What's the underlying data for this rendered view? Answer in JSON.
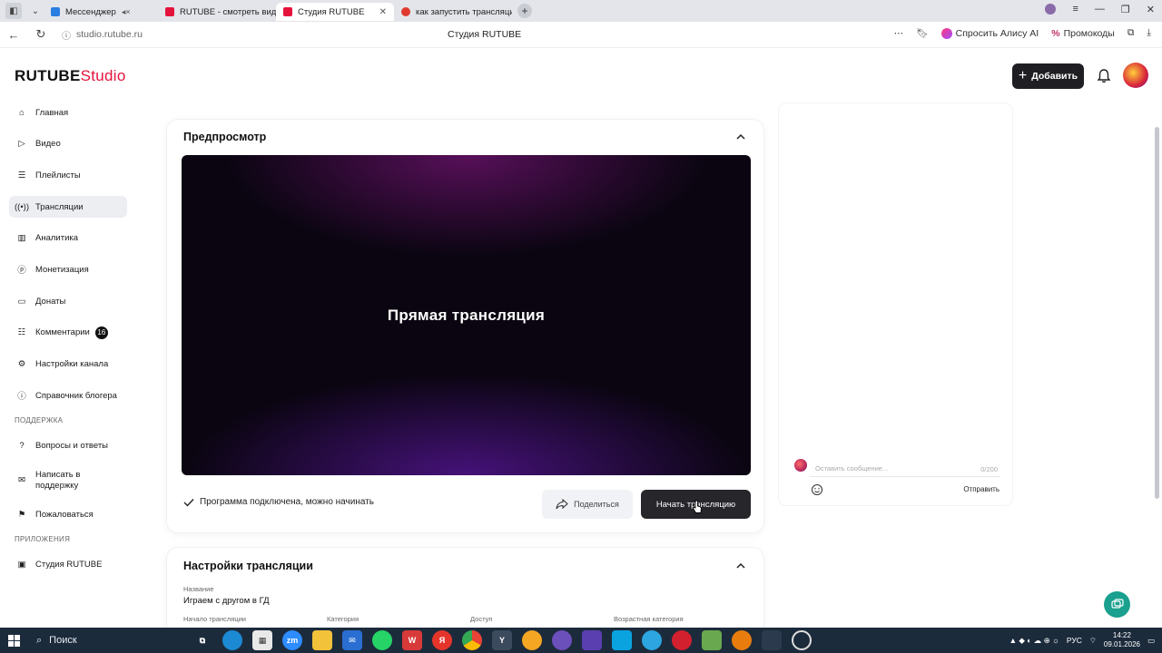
{
  "browser": {
    "tabs": [
      {
        "label": "Мессенджер",
        "favicon_color": "#2a7de1",
        "active": false
      },
      {
        "label": "RUTUBE - смотреть виде",
        "favicon_color": "#e5133c",
        "active": false
      },
      {
        "label": "Студия RUTUBE",
        "favicon_color": "#e5133c",
        "active": true
      },
      {
        "label": "как запустить трансляцию",
        "favicon_color": "#e03a2f",
        "active": false
      }
    ],
    "url": "studio.rutube.ru",
    "page_title": "Студия RUTUBE",
    "alice_label": "Спросить Алису AI",
    "promo_label": "Промокоды"
  },
  "header": {
    "logo_main": "RUTUBE",
    "logo_studio": "Studio",
    "add_label": "Добавить"
  },
  "sidebar": {
    "items": [
      {
        "label": "Главная",
        "icon": "home-icon"
      },
      {
        "label": "Видео",
        "icon": "video-icon"
      },
      {
        "label": "Плейлисты",
        "icon": "playlist-icon"
      },
      {
        "label": "Трансляции",
        "icon": "broadcast-icon",
        "active": true
      },
      {
        "label": "Аналитика",
        "icon": "analytics-icon"
      },
      {
        "label": "Монетизация",
        "icon": "monetization-icon"
      },
      {
        "label": "Донаты",
        "icon": "donate-icon"
      },
      {
        "label": "Комментарии",
        "icon": "comments-icon",
        "badge": "16"
      },
      {
        "label": "Настройки канала",
        "icon": "gear-icon"
      },
      {
        "label": "Справочник блогера",
        "icon": "info-icon"
      }
    ],
    "support_title": "ПОДДЕРЖКА",
    "support_items": [
      {
        "label": "Вопросы и ответы",
        "icon": "help-icon"
      },
      {
        "label": "Написать в поддержку",
        "icon": "mail-icon"
      },
      {
        "label": "Пожаловаться",
        "icon": "flag-icon"
      }
    ],
    "apps_title": "ПРИЛОЖЕНИЯ",
    "apps_items": [
      {
        "label": "Студия RUTUBE",
        "icon": "studio-icon"
      }
    ]
  },
  "preview": {
    "title": "Предпросмотр",
    "player_label": "Прямая трансляция",
    "status": "Программа подключена, можно начинать",
    "share_label": "Поделиться",
    "start_label": "Начать трансляцию"
  },
  "settings": {
    "title": "Настройки трансляции",
    "name_label": "Название",
    "name_value": "Играем с другом в ГД",
    "start_label": "Начало трансляции",
    "category_label": "Категория",
    "access_label": "Доступ",
    "age_label": "Возрастная категория"
  },
  "chat": {
    "placeholder": "Оставить сообщение...",
    "counter": "0/200",
    "send_label": "Отправить"
  },
  "taskbar": {
    "search_label": "Поиск",
    "language": "РУС",
    "time": "14:22",
    "date": "09.01.2026"
  }
}
